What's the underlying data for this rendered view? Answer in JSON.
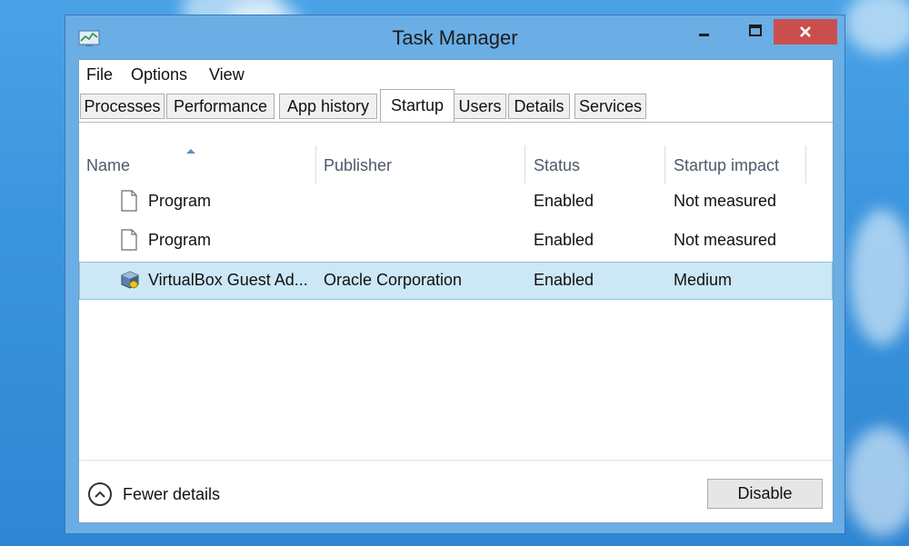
{
  "window": {
    "title": "Task Manager"
  },
  "menu": [
    "File",
    "Options",
    "View"
  ],
  "tabs": [
    {
      "label": "Processes"
    },
    {
      "label": "Performance"
    },
    {
      "label": "App history"
    },
    {
      "label": "Startup"
    },
    {
      "label": "Users"
    },
    {
      "label": "Details"
    },
    {
      "label": "Services"
    }
  ],
  "active_tab": "Startup",
  "columns": [
    "Name",
    "Publisher",
    "Status",
    "Startup impact"
  ],
  "rows": [
    {
      "name": "Program",
      "publisher": "",
      "status": "Enabled",
      "impact": "Not measured",
      "icon": "document-icon"
    },
    {
      "name": "Program",
      "publisher": "",
      "status": "Enabled",
      "impact": "Not measured",
      "icon": "document-icon"
    },
    {
      "name": "VirtualBox Guest Ad...",
      "publisher": "Oracle Corporation",
      "status": "Enabled",
      "impact": "Medium",
      "icon": "virtualbox-icon",
      "selected": true
    }
  ],
  "footer": {
    "fewer_details": "Fewer details",
    "disable": "Disable"
  },
  "colors": {
    "close": "#c94f4f",
    "selected_row": "#cce8f6",
    "window_frame": "#6aaee5"
  }
}
